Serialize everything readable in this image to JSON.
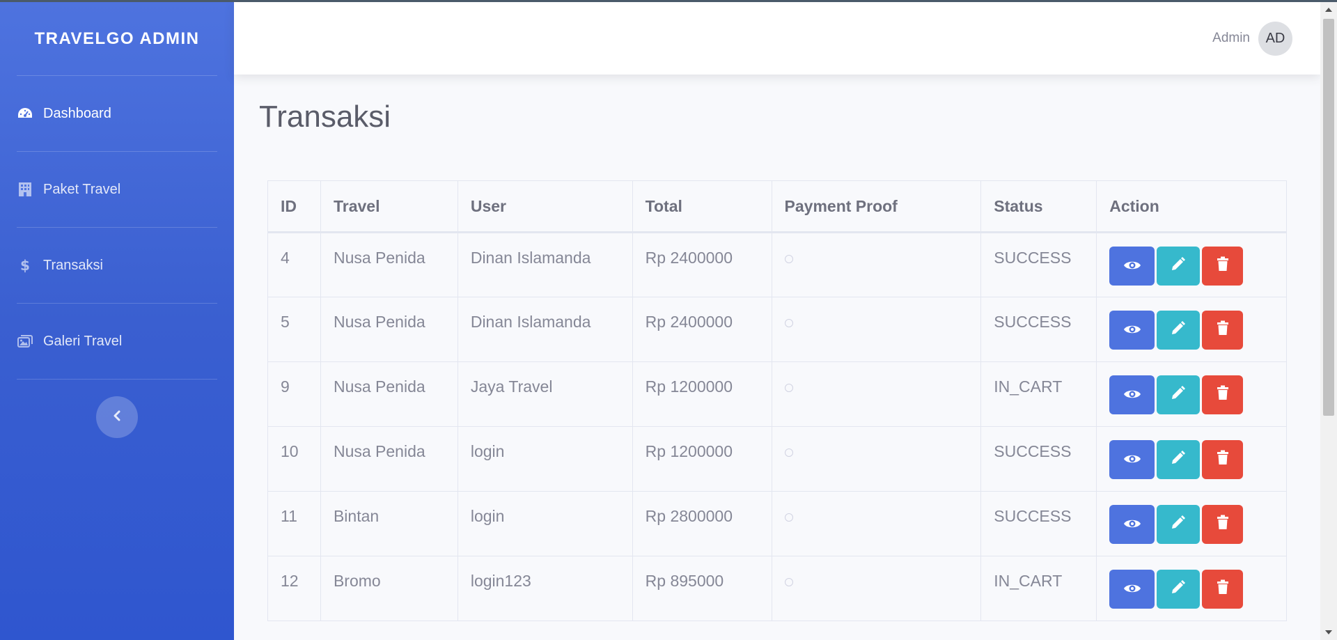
{
  "brand": "TRAVELGO ADMIN",
  "sidebar": {
    "items": [
      {
        "label": "Dashboard",
        "icon": "tachometer-icon"
      },
      {
        "label": "Paket Travel",
        "icon": "building-icon"
      },
      {
        "label": "Transaksi",
        "icon": "dollar-icon"
      },
      {
        "label": "Galeri Travel",
        "icon": "images-icon"
      }
    ],
    "toggle_icon": "chevron-left-icon"
  },
  "topbar": {
    "user_name": "Admin",
    "avatar_initials": "AD"
  },
  "page": {
    "title": "Transaksi"
  },
  "table": {
    "headers": [
      "ID",
      "Travel",
      "User",
      "Total",
      "Payment Proof",
      "Status",
      "Action"
    ],
    "rows": [
      {
        "id": "4",
        "travel": "Nusa Penida",
        "user": "Dinan Islamanda",
        "total": "Rp 2400000",
        "status": "SUCCESS"
      },
      {
        "id": "5",
        "travel": "Nusa Penida",
        "user": "Dinan Islamanda",
        "total": "Rp 2400000",
        "status": "SUCCESS"
      },
      {
        "id": "9",
        "travel": "Nusa Penida",
        "user": "Jaya Travel",
        "total": "Rp 1200000",
        "status": "IN_CART"
      },
      {
        "id": "10",
        "travel": "Nusa Penida",
        "user": "login",
        "total": "Rp 1200000",
        "status": "SUCCESS"
      },
      {
        "id": "11",
        "travel": "Bintan",
        "user": "login",
        "total": "Rp 2800000",
        "status": "SUCCESS"
      },
      {
        "id": "12",
        "travel": "Bromo",
        "user": "login123",
        "total": "Rp 895000",
        "status": "IN_CART"
      }
    ]
  },
  "colors": {
    "primary": "#4e73df",
    "info": "#36b9cc",
    "danger": "#e74a3b"
  }
}
